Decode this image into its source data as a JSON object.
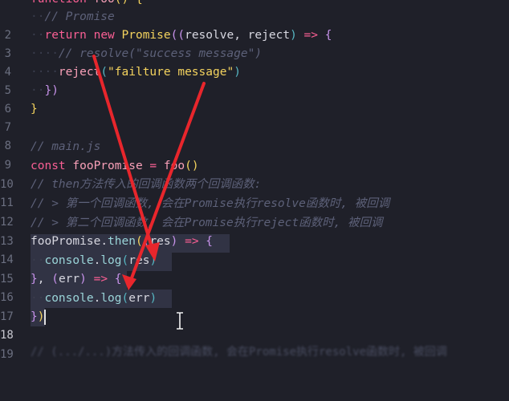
{
  "editor": {
    "lines": [
      {
        "num": "",
        "text": "function foo() {"
      },
      {
        "num": "2",
        "text": "// Promise"
      },
      {
        "num": "3",
        "text": "return new Promise((resolve, reject) => {"
      },
      {
        "num": "4",
        "text": "// resolve(\"success message\")"
      },
      {
        "num": "5",
        "text": "reject(\"failture message\")"
      },
      {
        "num": "6",
        "text": "})"
      },
      {
        "num": "7",
        "text": "}"
      },
      {
        "num": "8",
        "text": ""
      },
      {
        "num": "9",
        "text": "// main.js"
      },
      {
        "num": "10",
        "text": "const fooPromise = foo()"
      },
      {
        "num": "11",
        "text": "// then方法传入的回调函数两个回调函数:"
      },
      {
        "num": "12",
        "text": "// > 第一个回调函数, 会在Promise执行resolve函数时, 被回调"
      },
      {
        "num": "13",
        "text": "// > 第二个回调函数, 会在Promise执行reject函数时, 被回调"
      },
      {
        "num": "14",
        "text": "fooPromise.then((res) => {"
      },
      {
        "num": "15",
        "text": "console.log(res)"
      },
      {
        "num": "16",
        "text": "}, (err) => {"
      },
      {
        "num": "17",
        "text": "console.log(err)"
      },
      {
        "num": "18",
        "text": "})"
      },
      {
        "num": "19",
        "text": ""
      }
    ],
    "tokens": {
      "l1_kw": "function",
      "l1_fn": " foo",
      "l1_p": "() {",
      "l2_cm": "// Promise",
      "l3_ret": "return",
      "l3_new": " new ",
      "l3_cls": "Promise",
      "l3_p1": "((",
      "l3_a": "resolve",
      "l3_c": ", ",
      "l3_b": "reject",
      "l3_p2": ")",
      "l3_arrow": " => ",
      "l3_p3": "{",
      "l4_cm": "// resolve(\"success message\")",
      "l5_fn": "reject",
      "l5_p1": "(",
      "l5_str": "\"failture message\"",
      "l5_p2": ")",
      "l6_p": "})",
      "l7_p": "}",
      "l9_cm": "// main.js",
      "l10_kw": "const",
      "l10_var": " fooPromise",
      "l10_eq": " = ",
      "l10_fn": "foo",
      "l10_p": "()",
      "l11_cm": "// then方法传入的回调函数两个回调函数:",
      "l12_cm": "// > 第一个回调函数, 会在Promise执行resolve函数时, 被回调",
      "l13_cm": "// > 第二个回调函数, 会在Promise执行reject函数时, 被回调",
      "l14_var": "fooPromise",
      "l14_dot": ".",
      "l14_m": "then",
      "l14_p1": "(",
      "l14_p2": "(",
      "l14_a": "res",
      "l14_p3": ")",
      "l14_arrow": " => ",
      "l14_p4": "{",
      "l15_obj": "console",
      "l15_dot": ".",
      "l15_m": "log",
      "l15_p1": "(",
      "l15_a": "res",
      "l15_p2": ")",
      "l16_p1": "}",
      "l16_c": ", ",
      "l16_p2": "(",
      "l16_a": "err",
      "l16_p3": ")",
      "l16_arrow": " => ",
      "l16_p4": "{",
      "l17_obj": "console",
      "l17_dot": ".",
      "l17_m": "log",
      "l17_p1": "(",
      "l17_a": "err",
      "l17_p2": ")",
      "l18_p1": "}",
      "l18_p2": ")",
      "l20_cm": "// (.../...)方法传入的回调函数, 会在Promise执行resolve函数时, 被回调"
    },
    "active_line": "18"
  },
  "colors": {
    "background": "#1f2029",
    "arrow": "#e8262c"
  }
}
